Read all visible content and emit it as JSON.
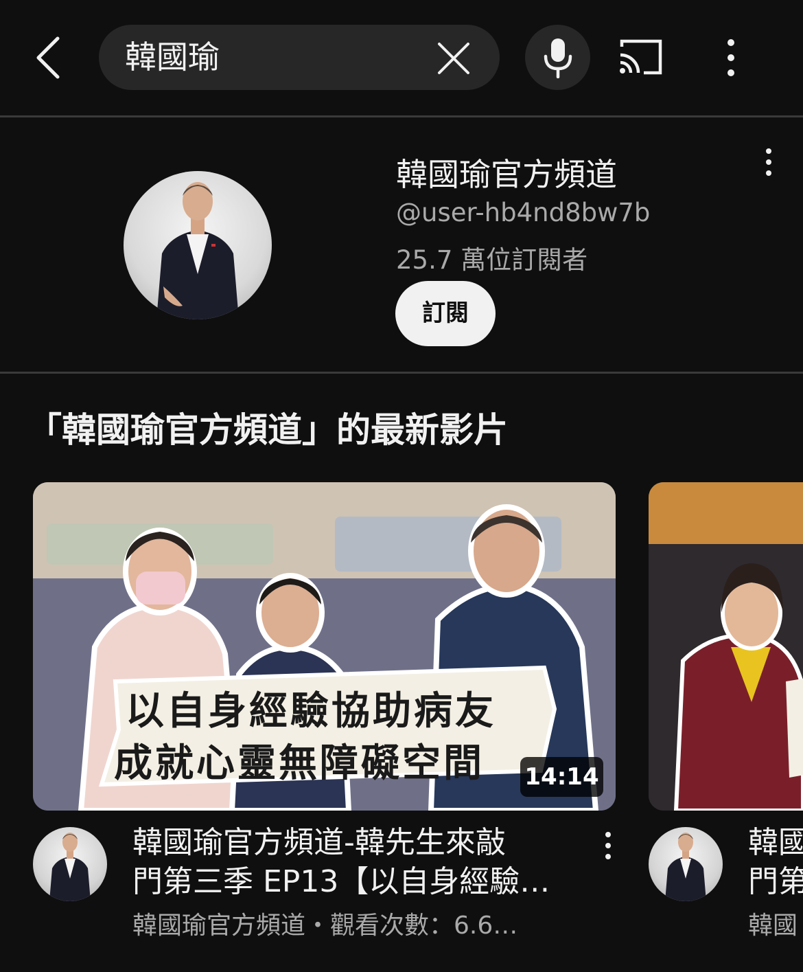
{
  "search": {
    "query": "韓國瑜"
  },
  "channel": {
    "name": "韓國瑜官方頻道",
    "handle": "@user-hb4nd8bw7b",
    "subscribers": "25.7 萬位訂閱者",
    "subscribe_label": "訂閱"
  },
  "section": {
    "title": "「韓國瑜官方頻道」的最新影片"
  },
  "videos": [
    {
      "duration": "14:14",
      "title_line1": "韓國瑜官方頻道-韓先生來敲",
      "title_line2": "門第三季 EP13【以自身經驗…",
      "meta": "韓國瑜官方頻道・觀看次數：6.6…",
      "thumbnail_caption_line1": "以自身經驗協助病友",
      "thumbnail_caption_line2": "成就心靈無障礙空間"
    },
    {
      "title_line1": "韓國",
      "title_line2": "門第",
      "meta": "韓國"
    }
  ],
  "icons": {
    "back": "arrow-left-icon",
    "clear": "close-icon",
    "mic": "microphone-icon",
    "cast": "cast-icon",
    "more": "more-vert-icon"
  },
  "colors": {
    "background": "#0f0f0f",
    "surface": "#272727",
    "text_primary": "#f1f1f1",
    "text_secondary": "#aaaaaa",
    "button_light": "#f1f1f1"
  }
}
